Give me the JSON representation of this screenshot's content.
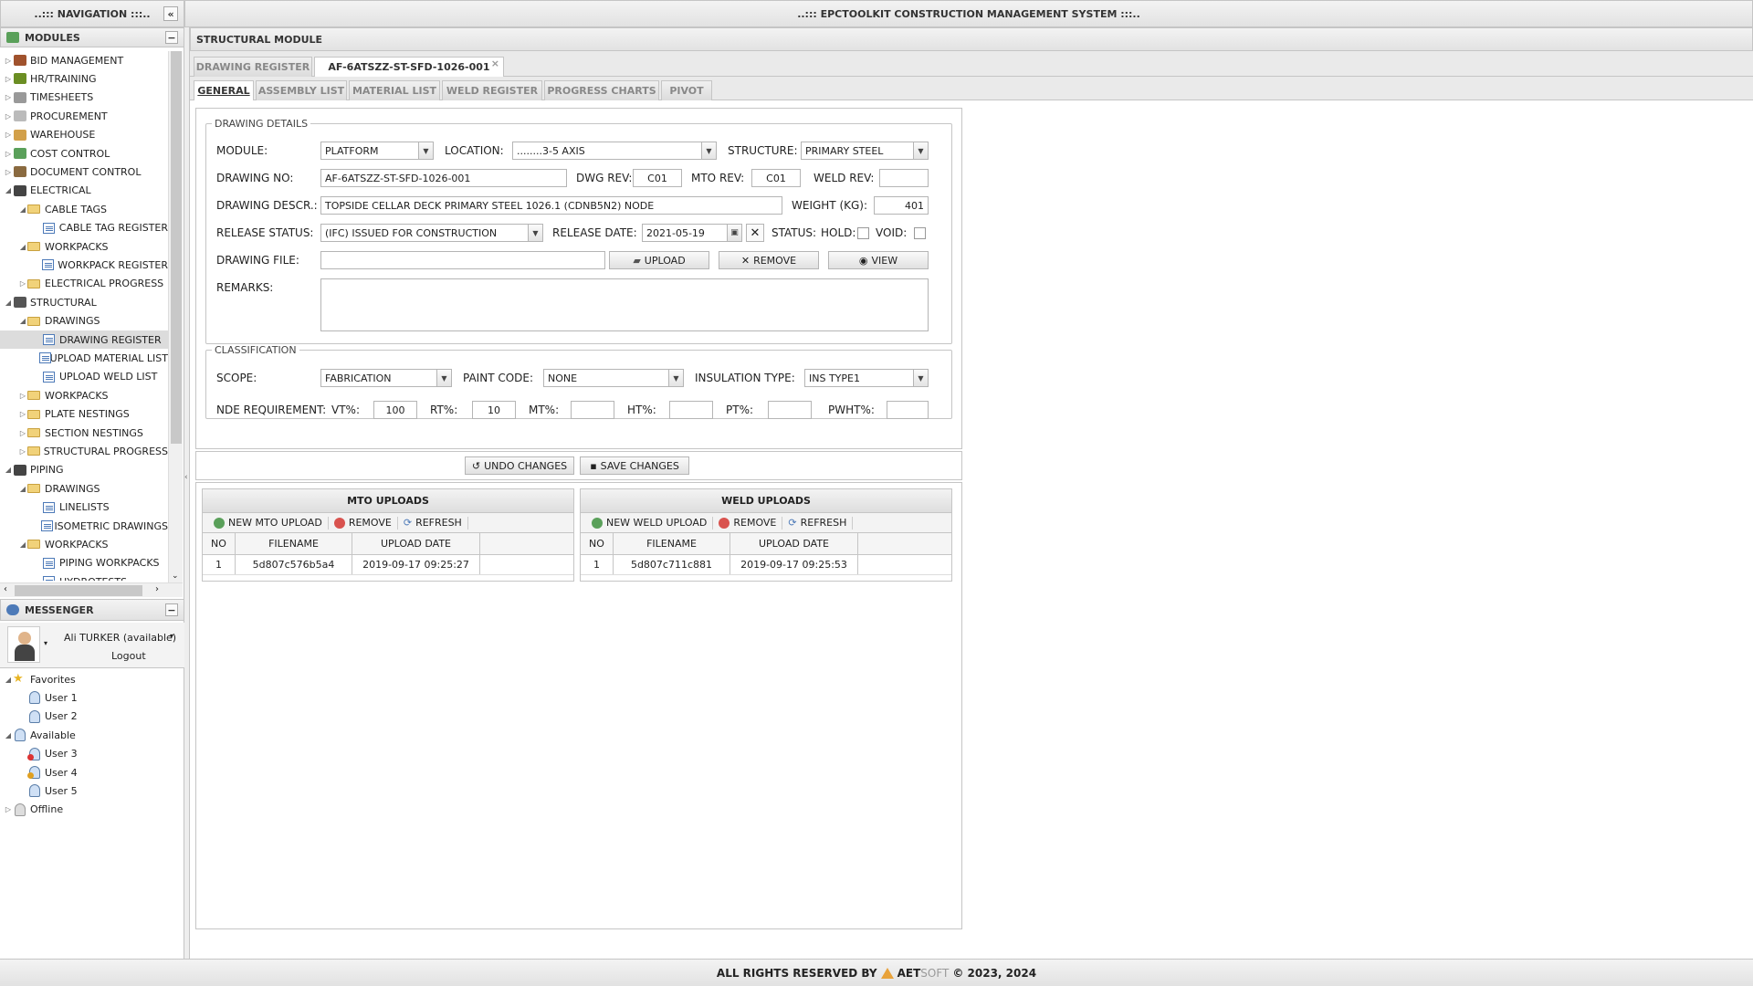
{
  "app": {
    "title": "..::: EPCTOOLKIT CONSTRUCTION MANAGEMENT SYSTEM :::..",
    "footer_prefix": "ALL RIGHTS RESERVED BY",
    "footer_brand_a": "AET",
    "footer_brand_b": "SOFT",
    "footer_suffix": "© 2023, 2024"
  },
  "nav": {
    "title": "..::: NAVIGATION :::..",
    "collapse": "«",
    "modules_title": "MODULES",
    "items": [
      {
        "label": "BID MANAGEMENT",
        "level": 0,
        "tw": "▷",
        "icon": "briefcase",
        "color": "#a0522d"
      },
      {
        "label": "HR/TRAINING",
        "level": 0,
        "tw": "▷",
        "icon": "people",
        "color": "#6b8e23"
      },
      {
        "label": "TIMESHEETS",
        "level": 0,
        "tw": "▷",
        "icon": "hourglass",
        "color": "#999"
      },
      {
        "label": "PROCUREMENT",
        "level": 0,
        "tw": "▷",
        "icon": "box",
        "color": "#bbb"
      },
      {
        "label": "WAREHOUSE",
        "level": 0,
        "tw": "▷",
        "icon": "forklift",
        "color": "#d2a04a"
      },
      {
        "label": "COST CONTROL",
        "level": 0,
        "tw": "▷",
        "icon": "money",
        "color": "#5aa05a"
      },
      {
        "label": "DOCUMENT CONTROL",
        "level": 0,
        "tw": "▷",
        "icon": "document",
        "color": "#8a6a40"
      },
      {
        "label": "ELECTRICAL",
        "level": 0,
        "tw": "◢",
        "icon": "tools",
        "color": "#444"
      },
      {
        "label": "CABLE TAGS",
        "level": 1,
        "tw": "◢",
        "icon": "folder"
      },
      {
        "label": "CABLE TAG REGISTER",
        "level": 2,
        "tw": "",
        "icon": "doc"
      },
      {
        "label": "WORKPACKS",
        "level": 1,
        "tw": "◢",
        "icon": "folder"
      },
      {
        "label": "WORKPACK REGISTER",
        "level": 2,
        "tw": "",
        "icon": "doc"
      },
      {
        "label": "ELECTRICAL PROGRESS",
        "level": 1,
        "tw": "▷",
        "icon": "folder"
      },
      {
        "label": "STRUCTURAL",
        "level": 0,
        "tw": "◢",
        "icon": "beam",
        "color": "#555"
      },
      {
        "label": "DRAWINGS",
        "level": 1,
        "tw": "◢",
        "icon": "folder"
      },
      {
        "label": "DRAWING REGISTER",
        "level": 2,
        "tw": "",
        "icon": "doc",
        "selected": true
      },
      {
        "label": "UPLOAD MATERIAL LIST",
        "level": 2,
        "tw": "",
        "icon": "doc"
      },
      {
        "label": "UPLOAD WELD LIST",
        "level": 2,
        "tw": "",
        "icon": "doc"
      },
      {
        "label": "WORKPACKS",
        "level": 1,
        "tw": "▷",
        "icon": "folder"
      },
      {
        "label": "PLATE NESTINGS",
        "level": 1,
        "tw": "▷",
        "icon": "folder"
      },
      {
        "label": "SECTION NESTINGS",
        "level": 1,
        "tw": "▷",
        "icon": "folder"
      },
      {
        "label": "STRUCTURAL PROGRESS",
        "level": 1,
        "tw": "▷",
        "icon": "folder"
      },
      {
        "label": "PIPING",
        "level": 0,
        "tw": "◢",
        "icon": "valve",
        "color": "#444"
      },
      {
        "label": "DRAWINGS",
        "level": 1,
        "tw": "◢",
        "icon": "folder"
      },
      {
        "label": "LINELISTS",
        "level": 2,
        "tw": "",
        "icon": "doc"
      },
      {
        "label": "ISOMETRIC DRAWINGS",
        "level": 2,
        "tw": "",
        "icon": "doc"
      },
      {
        "label": "WORKPACKS",
        "level": 1,
        "tw": "◢",
        "icon": "folder"
      },
      {
        "label": "PIPING WORKPACKS",
        "level": 2,
        "tw": "",
        "icon": "doc"
      },
      {
        "label": "HYDROTESTS",
        "level": 2,
        "tw": "",
        "icon": "doc"
      }
    ]
  },
  "messenger": {
    "title": "MESSENGER",
    "collapse": "−",
    "user": "Ali TURKER (available)",
    "logout": "Logout",
    "items": [
      {
        "label": "Favorites",
        "level": 0,
        "tw": "◢",
        "icon": "star"
      },
      {
        "label": "User 1",
        "level": 1,
        "tw": "",
        "icon": "user"
      },
      {
        "label": "User 2",
        "level": 1,
        "tw": "",
        "icon": "user"
      },
      {
        "label": "Available",
        "level": 0,
        "tw": "◢",
        "icon": "user"
      },
      {
        "label": "User 3",
        "level": 1,
        "tw": "",
        "icon": "user-busy"
      },
      {
        "label": "User 4",
        "level": 1,
        "tw": "",
        "icon": "user-away"
      },
      {
        "label": "User 5",
        "level": 1,
        "tw": "",
        "icon": "user"
      },
      {
        "label": "Offline",
        "level": 0,
        "tw": "▷",
        "icon": "user-off"
      }
    ]
  },
  "main": {
    "module_title": "STRUCTURAL MODULE",
    "doc_tabs": [
      {
        "label": "DRAWING REGISTER"
      },
      {
        "label": "AF-6ATSZZ-ST-SFD-1026-001",
        "active": true,
        "close": "×"
      }
    ],
    "sub_tabs": [
      "GENERAL",
      "ASSEMBLY LIST",
      "MATERIAL LIST",
      "WELD REGISTER",
      "PROGRESS CHARTS",
      "PIVOT"
    ],
    "details": {
      "legend": "DRAWING DETAILS",
      "module_label": "MODULE:",
      "module": "PLATFORM",
      "location_label": "LOCATION:",
      "location": "........3-5 AXIS",
      "structure_label": "STRUCTURE:",
      "structure": "PRIMARY STEEL",
      "drawing_no_label": "DRAWING NO:",
      "drawing_no": "AF-6ATSZZ-ST-SFD-1026-001",
      "dwg_rev_label": "DWG REV:",
      "dwg_rev": "C01",
      "mto_rev_label": "MTO REV:",
      "mto_rev": "C01",
      "weld_rev_label": "WELD REV:",
      "weld_rev": "",
      "descr_label": "DRAWING DESCR.:",
      "descr": "TOPSIDE CELLAR DECK PRIMARY STEEL 1026.1 (CDNB5N2) NODE",
      "weight_label": "WEIGHT (KG):",
      "weight": "401",
      "release_status_label": "RELEASE STATUS:",
      "release_status": "(IFC) ISSUED FOR CONSTRUCTION",
      "release_date_label": "RELEASE DATE:",
      "release_date": "2021-05-19",
      "status_label": "STATUS:",
      "hold_label": "HOLD:",
      "void_label": "VOID:",
      "file_label": "DRAWING FILE:",
      "file": "",
      "upload": "UPLOAD",
      "remove": "REMOVE",
      "view": "VIEW",
      "remarks_label": "REMARKS:",
      "remarks": ""
    },
    "classification": {
      "legend": "CLASSIFICATION",
      "scope_label": "SCOPE:",
      "scope": "FABRICATION",
      "paint_label": "PAINT CODE:",
      "paint": "NONE",
      "ins_label": "INSULATION TYPE:",
      "ins": "INS TYPE1",
      "nde_label": "NDE REQUIREMENT:",
      "vt_label": "VT%:",
      "vt": "100",
      "rt_label": "RT%:",
      "rt": "10",
      "mt_label": "MT%:",
      "mt": "",
      "ht_label": "HT%:",
      "ht": "",
      "pt_label": "PT%:",
      "pt": "",
      "pwht_label": "PWHT%:",
      "pwht": ""
    },
    "actions": {
      "undo": "UNDO CHANGES",
      "save": "SAVE CHANGES"
    },
    "mto": {
      "title": "MTO UPLOADS",
      "new": "NEW MTO UPLOAD",
      "remove": "REMOVE",
      "refresh": "REFRESH",
      "cols": [
        "NO",
        "FILENAME",
        "UPLOAD DATE"
      ],
      "rows": [
        [
          "1",
          "5d807c576b5a4",
          "2019-09-17 09:25:27"
        ]
      ]
    },
    "weld": {
      "title": "WELD UPLOADS",
      "new": "NEW WELD UPLOAD",
      "remove": "REMOVE",
      "refresh": "REFRESH",
      "cols": [
        "NO",
        "FILENAME",
        "UPLOAD DATE"
      ],
      "rows": [
        [
          "1",
          "5d807c711c881",
          "2019-09-17 09:25:53"
        ]
      ]
    }
  }
}
